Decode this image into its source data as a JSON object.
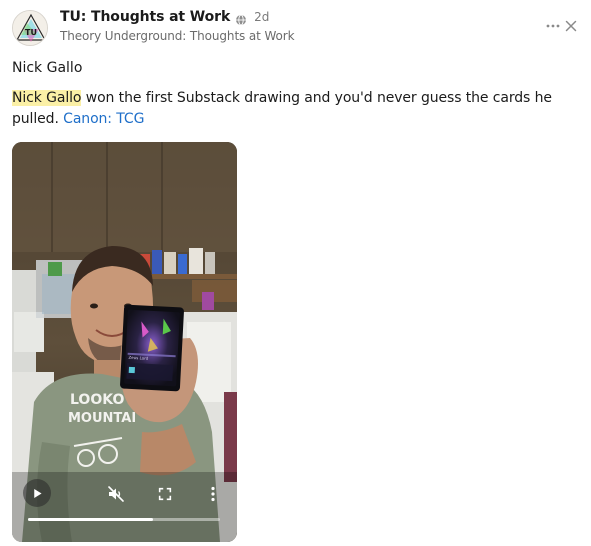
{
  "post": {
    "publication_name": "TU: Thoughts at Work",
    "time_ago": "2d",
    "publication_subtitle": "Theory Underground: Thoughts at Work",
    "author": "Nick Gallo",
    "body_highlight": "Nick Gallo",
    "body_text": " won the first Substack drawing and you'd never guess the cards he pulled. ",
    "body_link": "Canon: TCG",
    "avatar_text": "TU"
  },
  "icons": {
    "globe": "globe-icon",
    "more": "more-horizontal-icon",
    "close": "close-icon",
    "play": "play-icon",
    "mute": "volume-muted-icon",
    "fullscreen": "fullscreen-icon",
    "menu": "more-vertical-icon"
  },
  "video": {
    "progress": 0.65,
    "shirt_text_line1": "LOOKO",
    "shirt_text_line2": "MOUNTAI",
    "card_label": "Zeus Lord"
  },
  "colors": {
    "highlight": "#fbf0a6",
    "link": "#1f6fc9"
  }
}
